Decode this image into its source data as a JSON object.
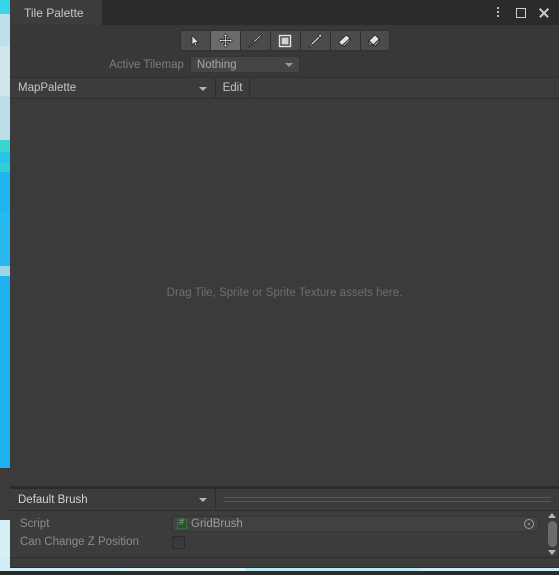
{
  "window": {
    "tab_label": "Tile Palette",
    "controls": [
      {
        "name": "more-menu",
        "icon": "kebab-menu-icon",
        "label": "⋮"
      },
      {
        "name": "maximize",
        "icon": "maximize-icon",
        "label": "□"
      },
      {
        "name": "close",
        "icon": "close-icon",
        "label": "✕"
      }
    ]
  },
  "toolbar": {
    "tools": [
      {
        "id": "select",
        "icon": "cursor-arrow-icon",
        "tooltip": "Select",
        "selected": false
      },
      {
        "id": "move",
        "icon": "move-arrows-icon",
        "tooltip": "Move",
        "selected": true
      },
      {
        "id": "paint",
        "icon": "paint-brush-icon",
        "tooltip": "Paint",
        "selected": false
      },
      {
        "id": "box-fill",
        "icon": "filled-square-icon",
        "tooltip": "Box Fill",
        "selected": false
      },
      {
        "id": "picker",
        "icon": "eyedropper-icon",
        "tooltip": "Picker",
        "selected": false
      },
      {
        "id": "erase",
        "icon": "eraser-icon",
        "tooltip": "Erase",
        "selected": false
      },
      {
        "id": "fill",
        "icon": "paint-bucket-icon",
        "tooltip": "Fill",
        "selected": false
      }
    ]
  },
  "active_tilemap": {
    "label": "Active Tilemap",
    "value": "Nothing",
    "caret_icon": "chevron-down-icon"
  },
  "palette": {
    "selected": "MapPalette",
    "edit_label": "Edit",
    "caret_icon": "chevron-down-icon"
  },
  "canvas": {
    "hint": "Drag Tile, Sprite or Sprite Texture assets here."
  },
  "brush": {
    "selected": "Default Brush",
    "caret_icon": "chevron-down-icon",
    "drag_handle_icon": "drag-handle-icon"
  },
  "inspector": {
    "rows": [
      {
        "label": "Script",
        "type": "object-field",
        "value": "GridBrush",
        "value_icon": "csharp-script-icon",
        "picker_icon": "object-picker-icon"
      },
      {
        "label": "Can Change Z Position",
        "type": "checkbox",
        "checked": false
      }
    ]
  },
  "scrollbar": {
    "up_icon": "scroll-up-arrow-icon",
    "down_icon": "scroll-down-arrow-icon",
    "thumb_name": "scroll-thumb"
  },
  "colors": {
    "window_bg": "#383838",
    "tab_bg": "#3c3c3c",
    "tabbar_bg": "#2b2b2b",
    "canvas_bg": "#3b3b3b",
    "text": "#c4c4c4",
    "muted_text": "#8c8c8c",
    "hint_text": "#6e6e6e",
    "tool_bg": "#4b4b4b",
    "tool_selected_bg": "#6b6b6b",
    "scene_cyan": "#1fb6f0",
    "scene_blue": "#2d4a80"
  }
}
